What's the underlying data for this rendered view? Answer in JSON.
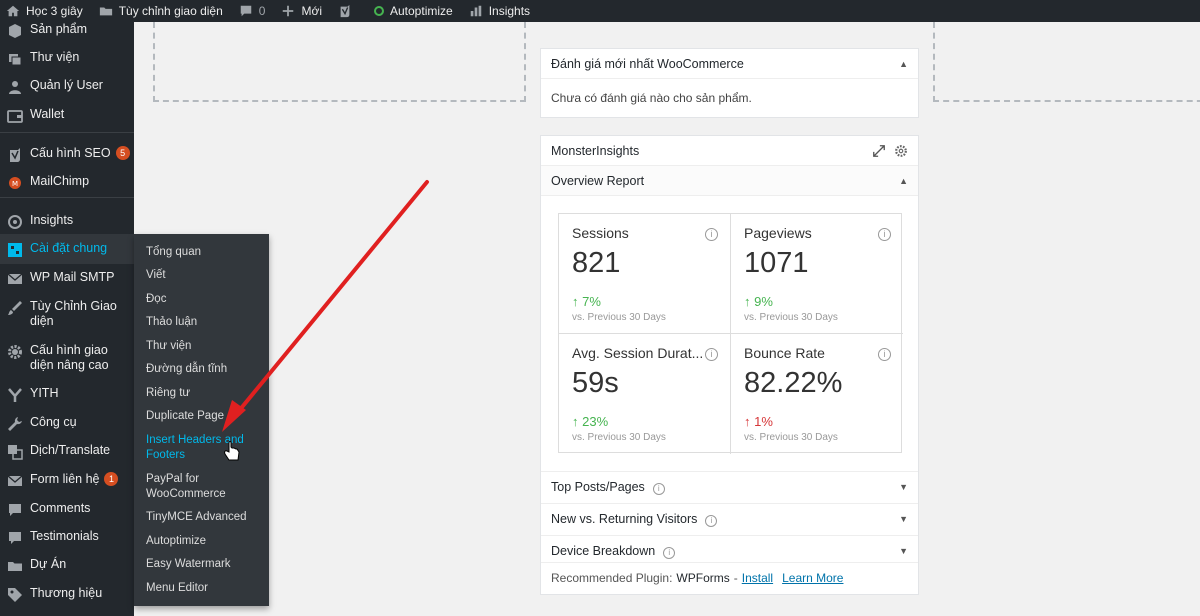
{
  "adminbar": {
    "items": [
      {
        "label": "Học 3 giây",
        "icon": "home-icon"
      },
      {
        "label": "Tùy chỉnh giao diện",
        "icon": "folder-icon"
      },
      {
        "label": "0",
        "icon": "comment-icon"
      },
      {
        "label": "Mới",
        "icon": "plus-icon"
      },
      {
        "label": "",
        "icon": "yoast-icon"
      },
      {
        "label": "Autoptimize",
        "icon": "status-dot-icon"
      },
      {
        "label": "Insights",
        "icon": "bar-chart-icon"
      }
    ]
  },
  "sidebar": {
    "items": [
      {
        "label": "Sản phẩm",
        "icon": "product-icon"
      },
      {
        "label": "Thư viện",
        "icon": "media-icon"
      },
      {
        "label": "Quản lý User",
        "icon": "user-icon"
      },
      {
        "label": "Wallet",
        "icon": "wallet-icon"
      },
      {
        "label": "Cấu hình SEO",
        "icon": "yoast-icon",
        "badge": "5"
      },
      {
        "label": "MailChimp",
        "icon": "mailchimp-icon"
      },
      {
        "label": "Insights",
        "icon": "insights-icon"
      },
      {
        "label": "Cài đặt chung",
        "icon": "settings-icon"
      },
      {
        "label": "WP Mail SMTP",
        "icon": "mail-icon"
      },
      {
        "label": "Tùy Chỉnh Giao diện",
        "icon": "brush-icon"
      },
      {
        "label": "Cấu hình giao diện nâng cao",
        "icon": "gear-icon"
      },
      {
        "label": "YITH",
        "icon": "yith-icon"
      },
      {
        "label": "Công cụ",
        "icon": "wrench-icon"
      },
      {
        "label": "Dịch/Translate",
        "icon": "translate-icon"
      },
      {
        "label": "Form liên hệ",
        "icon": "envelope-icon",
        "badge": "1"
      },
      {
        "label": "Comments",
        "icon": "comment-icon"
      },
      {
        "label": "Testimonials",
        "icon": "quote-icon"
      },
      {
        "label": "Dự Án",
        "icon": "folder-icon"
      },
      {
        "label": "Thương hiệu",
        "icon": "tag-icon"
      }
    ]
  },
  "submenu": {
    "items": [
      "Tổng quan",
      "Viết",
      "Đọc",
      "Thảo luận",
      "Thư viện",
      "Đường dẫn tĩnh",
      "Riêng tư",
      "Duplicate Page",
      "Insert Headers and Footers",
      "PayPal for WooCommerce",
      "TinyMCE Advanced",
      "Autoptimize",
      "Easy Watermark",
      "Menu Editor"
    ]
  },
  "woo_widget": {
    "title": "Đánh giá mới nhất WooCommerce",
    "body": "Chưa có đánh giá nào cho sản phẩm."
  },
  "monster": {
    "title": "MonsterInsights",
    "subtitle": "Overview Report",
    "stats": [
      {
        "title": "Sessions",
        "value": "821",
        "change": "7%",
        "direction": "up",
        "period": "vs. Previous 30 Days"
      },
      {
        "title": "Pageviews",
        "value": "1071",
        "change": "9%",
        "direction": "up",
        "period": "vs. Previous 30 Days"
      },
      {
        "title": "Avg. Session Durat...",
        "value": "59s",
        "change": "23%",
        "direction": "up",
        "period": "vs. Previous 30 Days"
      },
      {
        "title": "Bounce Rate",
        "value": "82.22%",
        "change": "1%",
        "direction": "up",
        "period": "vs. Previous 30 Days"
      }
    ],
    "sections": [
      "Top Posts/Pages",
      "New vs. Returning Visitors",
      "Device Breakdown"
    ],
    "recommended_label": "Recommended Plugin:",
    "recommended_plugin": "WPForms",
    "install_link": "Install",
    "learn_more_link": "Learn More"
  },
  "colors": {
    "admin_bg": "#23282d",
    "accent": "#00b9eb",
    "up": "#46b450",
    "down": "#d63638",
    "badge": "#d54e21",
    "arrow": "#e02020"
  }
}
